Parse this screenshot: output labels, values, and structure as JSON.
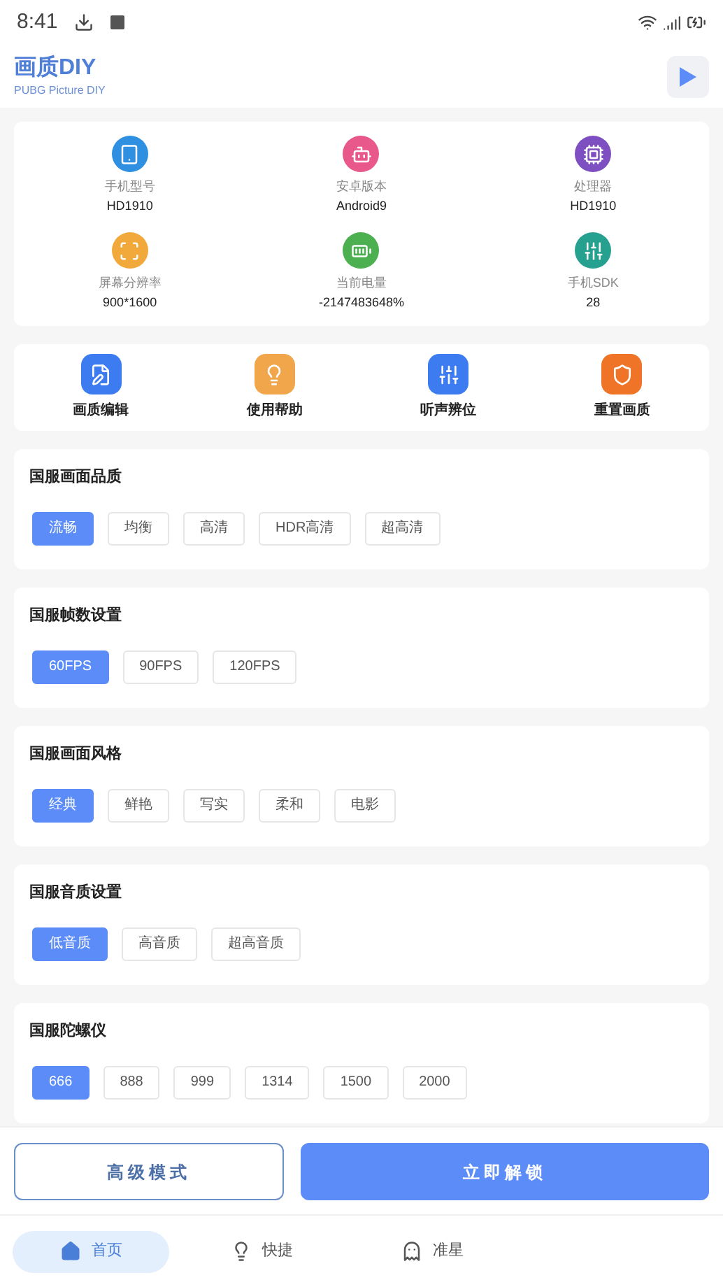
{
  "status_bar": {
    "time": "8:41"
  },
  "header": {
    "title": "画质DIY",
    "subtitle": "PUBG Picture DIY"
  },
  "device_info": [
    {
      "kind": "phone",
      "label": "手机型号",
      "value": "HD1910",
      "color": "#2f8fe0"
    },
    {
      "kind": "android",
      "label": "安卓版本",
      "value": "Android9",
      "color": "#e8588a"
    },
    {
      "kind": "cpu",
      "label": "处理器",
      "value": "HD1910",
      "color": "#7e4fc0"
    },
    {
      "kind": "screen",
      "label": "屏幕分辨率",
      "value": "900*1600",
      "color": "#f2a93b"
    },
    {
      "kind": "battery",
      "label": "当前电量",
      "value": "-2147483648%",
      "color": "#4caf50"
    },
    {
      "kind": "sliders",
      "label": "手机SDK",
      "value": "28",
      "color": "#26a08f"
    }
  ],
  "tools": [
    {
      "kind": "edit",
      "label": "画质编辑",
      "color": "#3d7bf0"
    },
    {
      "kind": "bulb",
      "label": "使用帮助",
      "color": "#f2a64b"
    },
    {
      "kind": "sliders",
      "label": "听声辨位",
      "color": "#3d7bf0"
    },
    {
      "kind": "shield",
      "label": "重置画质",
      "color": "#f07428"
    }
  ],
  "sections": [
    {
      "title": "国服画面品质",
      "options": [
        {
          "label": "流畅",
          "selected": true
        },
        {
          "label": "均衡",
          "selected": false
        },
        {
          "label": "高清",
          "selected": false
        },
        {
          "label": "HDR高清",
          "selected": false
        },
        {
          "label": "超高清",
          "selected": false
        }
      ]
    },
    {
      "title": "国服帧数设置",
      "options": [
        {
          "label": "60FPS",
          "selected": true
        },
        {
          "label": "90FPS",
          "selected": false
        },
        {
          "label": "120FPS",
          "selected": false
        }
      ]
    },
    {
      "title": "国服画面风格",
      "options": [
        {
          "label": "经典",
          "selected": true
        },
        {
          "label": "鲜艳",
          "selected": false
        },
        {
          "label": "写实",
          "selected": false
        },
        {
          "label": "柔和",
          "selected": false
        },
        {
          "label": "电影",
          "selected": false
        }
      ]
    },
    {
      "title": "国服音质设置",
      "options": [
        {
          "label": "低音质",
          "selected": true
        },
        {
          "label": "高音质",
          "selected": false
        },
        {
          "label": "超高音质",
          "selected": false
        }
      ]
    },
    {
      "title": "国服陀螺仪",
      "options": [
        {
          "label": "666",
          "selected": true
        },
        {
          "label": "888",
          "selected": false
        },
        {
          "label": "999",
          "selected": false
        },
        {
          "label": "1314",
          "selected": false
        },
        {
          "label": "1500",
          "selected": false
        },
        {
          "label": "2000",
          "selected": false
        }
      ]
    }
  ],
  "actions": {
    "advanced": "高级模式",
    "unlock": "立即解锁"
  },
  "bottom_nav": [
    {
      "kind": "home",
      "label": "首页",
      "selected": true
    },
    {
      "kind": "bulb",
      "label": "快捷",
      "selected": false
    },
    {
      "kind": "alien",
      "label": "准星",
      "selected": false
    }
  ]
}
